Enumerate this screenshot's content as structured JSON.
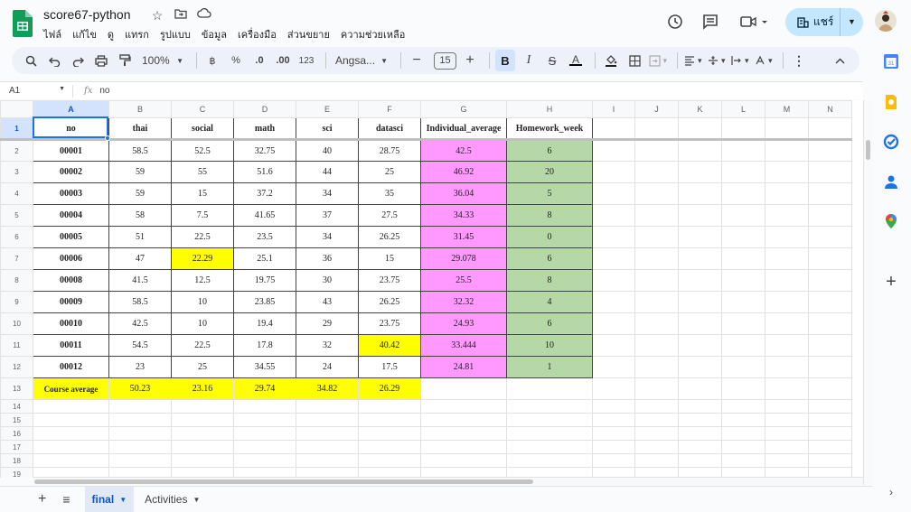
{
  "doc": {
    "title": "score67-python"
  },
  "menu": [
    "ไฟล์",
    "แก้ไข",
    "ดู",
    "แทรก",
    "รูปแบบ",
    "ข้อมูล",
    "เครื่องมือ",
    "ส่วนขยาย",
    "ความช่วยเหลือ"
  ],
  "share": {
    "label": "แชร์"
  },
  "toolbar": {
    "zoom": "100%",
    "currency": "฿",
    "percent": "%",
    "dec_dec": ".0",
    "dec_inc": ".00",
    "format123": "123",
    "font": "Angsa...",
    "font_size": "15",
    "bold": "B",
    "italic": "I",
    "strike": "S",
    "text_color": "A"
  },
  "formula_bar": {
    "cell_ref": "A1",
    "fx": "fx",
    "value": "no"
  },
  "columns": [
    "A",
    "B",
    "C",
    "D",
    "E",
    "F",
    "G",
    "H",
    "I",
    "J",
    "K",
    "L",
    "M",
    "N"
  ],
  "row_numbers": [
    "1",
    "2",
    "3",
    "4",
    "5",
    "6",
    "7",
    "8",
    "9",
    "10",
    "11",
    "12",
    "13",
    "14",
    "15",
    "16",
    "17",
    "18",
    "19"
  ],
  "table": {
    "headers": [
      "no",
      "thai",
      "social",
      "math",
      "sci",
      "datasci",
      "Individual_average",
      "Homework_week"
    ],
    "rows": [
      [
        "00001",
        "58.5",
        "52.5",
        "32.75",
        "40",
        "28.75",
        "42.5",
        "6"
      ],
      [
        "00002",
        "59",
        "55",
        "51.6",
        "44",
        "25",
        "46.92",
        "20"
      ],
      [
        "00003",
        "59",
        "15",
        "37.2",
        "34",
        "35",
        "36.04",
        "5"
      ],
      [
        "00004",
        "58",
        "7.5",
        "41.65",
        "37",
        "27.5",
        "34.33",
        "8"
      ],
      [
        "00005",
        "51",
        "22.5",
        "23.5",
        "34",
        "26.25",
        "31.45",
        "0"
      ],
      [
        "00006",
        "47",
        "22.29",
        "25.1",
        "36",
        "15",
        "29.078",
        "6"
      ],
      [
        "00008",
        "41.5",
        "12.5",
        "19.75",
        "30",
        "23.75",
        "25.5",
        "8"
      ],
      [
        "00009",
        "58.5",
        "10",
        "23.85",
        "43",
        "26.25",
        "32.32",
        "4"
      ],
      [
        "00010",
        "42.5",
        "10",
        "19.4",
        "29",
        "23.75",
        "24.93",
        "6"
      ],
      [
        "00011",
        "54.5",
        "22.5",
        "17.8",
        "32",
        "40.42",
        "33.444",
        "10"
      ],
      [
        "00012",
        "23",
        "25",
        "34.55",
        "24",
        "17.5",
        "24.81",
        "1"
      ]
    ],
    "average_row": [
      "Course average",
      "50.23",
      "23.16",
      "29.74",
      "34.82",
      "26.29"
    ]
  },
  "sheets": {
    "active": "final",
    "other": "Activities"
  },
  "colors": {
    "highlight_pink": "#ff99ff",
    "highlight_green": "#b6d7a8",
    "highlight_yellow": "#ffff00",
    "accent": "#0b57d0"
  },
  "icons": [
    "history-icon",
    "comment-icon",
    "meet-icon",
    "share-icon",
    "calendar-icon",
    "keep-icon",
    "tasks-icon",
    "contacts-icon",
    "maps-icon",
    "add-icon"
  ]
}
